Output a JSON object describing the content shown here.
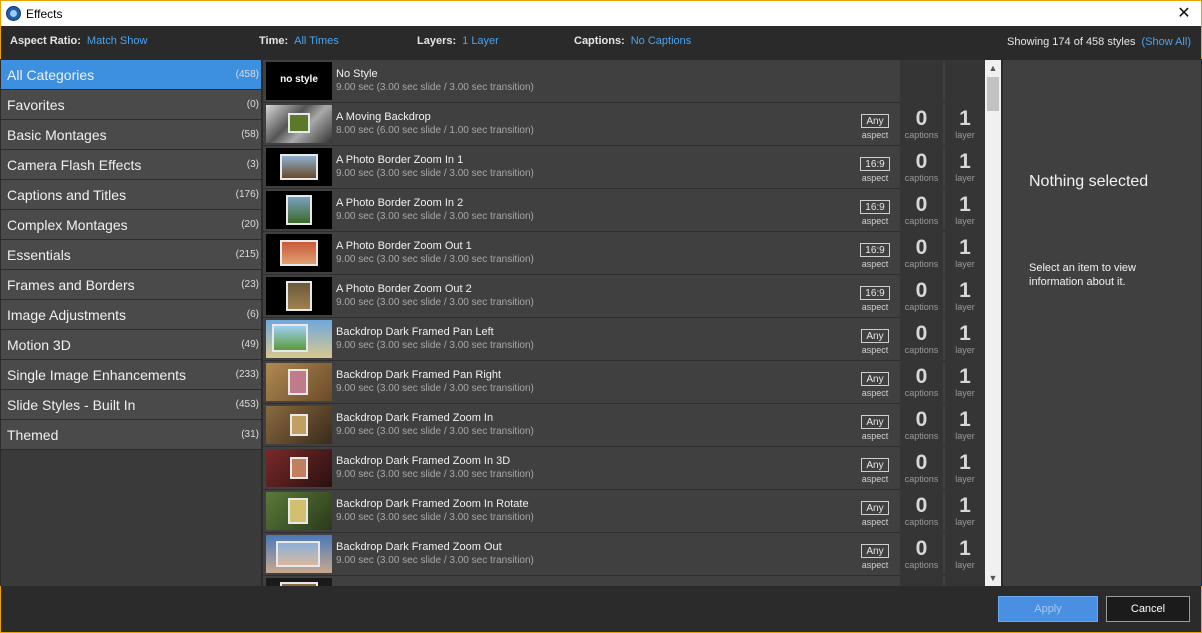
{
  "window": {
    "title": "Effects",
    "close_glyph": "✕",
    "app_icon": "app-logo-icon"
  },
  "filters": {
    "aspect_label": "Aspect Ratio:",
    "aspect_value": "Match Show",
    "time_label": "Time:",
    "time_value": "All Times",
    "layers_label": "Layers:",
    "layers_value": "1 Layer",
    "captions_label": "Captions:",
    "captions_value": "No Captions",
    "showing_text": "Showing 174 of 458 styles",
    "show_all": "(Show All)"
  },
  "categories": [
    {
      "name": "All Categories",
      "count": "(458)"
    },
    {
      "name": "Favorites",
      "count": "(0)"
    },
    {
      "name": "Basic Montages",
      "count": "(58)"
    },
    {
      "name": "Camera Flash Effects",
      "count": "(3)"
    },
    {
      "name": "Captions and Titles",
      "count": "(176)"
    },
    {
      "name": "Complex Montages",
      "count": "(20)"
    },
    {
      "name": "Essentials",
      "count": "(215)"
    },
    {
      "name": "Frames and Borders",
      "count": "(23)"
    },
    {
      "name": "Image Adjustments",
      "count": "(6)"
    },
    {
      "name": "Motion 3D",
      "count": "(49)"
    },
    {
      "name": "Single Image Enhancements",
      "count": "(233)"
    },
    {
      "name": "Slide Styles - Built In",
      "count": "(453)"
    },
    {
      "name": "Themed",
      "count": "(31)"
    }
  ],
  "styles": [
    {
      "thumb": "no style",
      "name": "No Style",
      "duration": "9.00 sec (3.00 sec slide / 3.00 sec transition)",
      "aspect": "",
      "aspect_label": "",
      "captions": "",
      "captions_label": "",
      "layers": "",
      "layers_label": ""
    },
    {
      "thumb": "",
      "name": "A Moving Backdrop",
      "duration": "8.00 sec (6.00 sec slide / 1.00 sec transition)",
      "aspect": "Any",
      "aspect_label": "aspect",
      "captions": "0",
      "captions_label": "captions",
      "layers": "1",
      "layers_label": "layer"
    },
    {
      "thumb": "",
      "name": "A Photo Border Zoom In 1",
      "duration": "9.00 sec (3.00 sec slide / 3.00 sec transition)",
      "aspect": "16:9",
      "aspect_label": "aspect",
      "captions": "0",
      "captions_label": "captions",
      "layers": "1",
      "layers_label": "layer"
    },
    {
      "thumb": "",
      "name": "A Photo Border Zoom In 2",
      "duration": "9.00 sec (3.00 sec slide / 3.00 sec transition)",
      "aspect": "16:9",
      "aspect_label": "aspect",
      "captions": "0",
      "captions_label": "captions",
      "layers": "1",
      "layers_label": "layer"
    },
    {
      "thumb": "",
      "name": "A Photo Border Zoom Out 1",
      "duration": "9.00 sec (3.00 sec slide / 3.00 sec transition)",
      "aspect": "16:9",
      "aspect_label": "aspect",
      "captions": "0",
      "captions_label": "captions",
      "layers": "1",
      "layers_label": "layer"
    },
    {
      "thumb": "",
      "name": "A Photo Border Zoom Out 2",
      "duration": "9.00 sec (3.00 sec slide / 3.00 sec transition)",
      "aspect": "16:9",
      "aspect_label": "aspect",
      "captions": "0",
      "captions_label": "captions",
      "layers": "1",
      "layers_label": "layer"
    },
    {
      "thumb": "",
      "name": "Backdrop Dark Framed Pan Left",
      "duration": "9.00 sec (3.00 sec slide / 3.00 sec transition)",
      "aspect": "Any",
      "aspect_label": "aspect",
      "captions": "0",
      "captions_label": "captions",
      "layers": "1",
      "layers_label": "layer"
    },
    {
      "thumb": "",
      "name": "Backdrop Dark Framed Pan Right",
      "duration": "9.00 sec (3.00 sec slide / 3.00 sec transition)",
      "aspect": "Any",
      "aspect_label": "aspect",
      "captions": "0",
      "captions_label": "captions",
      "layers": "1",
      "layers_label": "layer"
    },
    {
      "thumb": "",
      "name": "Backdrop Dark Framed Zoom In",
      "duration": "9.00 sec (3.00 sec slide / 3.00 sec transition)",
      "aspect": "Any",
      "aspect_label": "aspect",
      "captions": "0",
      "captions_label": "captions",
      "layers": "1",
      "layers_label": "layer"
    },
    {
      "thumb": "",
      "name": "Backdrop Dark Framed Zoom In 3D",
      "duration": "9.00 sec (3.00 sec slide / 3.00 sec transition)",
      "aspect": "Any",
      "aspect_label": "aspect",
      "captions": "0",
      "captions_label": "captions",
      "layers": "1",
      "layers_label": "layer"
    },
    {
      "thumb": "",
      "name": "Backdrop Dark Framed Zoom In Rotate",
      "duration": "9.00 sec (3.00 sec slide / 3.00 sec transition)",
      "aspect": "Any",
      "aspect_label": "aspect",
      "captions": "0",
      "captions_label": "captions",
      "layers": "1",
      "layers_label": "layer"
    },
    {
      "thumb": "",
      "name": "Backdrop Dark Framed Zoom Out",
      "duration": "9.00 sec (3.00 sec slide / 3.00 sec transition)",
      "aspect": "Any",
      "aspect_label": "aspect",
      "captions": "0",
      "captions_label": "captions",
      "layers": "1",
      "layers_label": "layer"
    },
    {
      "thumb": "",
      "name": "",
      "duration": "",
      "aspect": "",
      "aspect_label": "",
      "captions": "",
      "captions_label": "",
      "layers": "",
      "layers_label": ""
    }
  ],
  "info_panel": {
    "heading": "Nothing selected",
    "description": "Select an item to view information about it."
  },
  "buttons": {
    "apply": "Apply",
    "cancel": "Cancel"
  },
  "colors": {
    "accent": "#3d8fe0",
    "link": "#4aa3f2",
    "window_border": "#e8a300"
  },
  "scroll": {
    "up": "▲",
    "down": "▼"
  }
}
